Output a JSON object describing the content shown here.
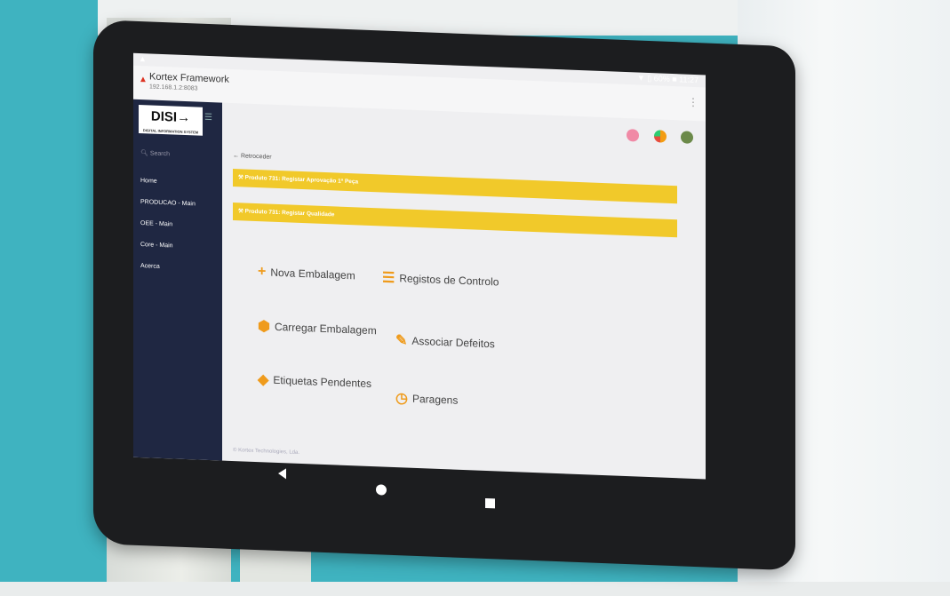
{
  "status": {
    "left": "▲",
    "right": "▼ ▯ 60% ■ 11:27"
  },
  "titlebar": {
    "warn": "▲",
    "app_name": "Kortex Framework",
    "ip": "192.168.1.2:8083",
    "menu": "⋮"
  },
  "sidebar": {
    "logo": "DISI→",
    "logo_sub": "DIGITAL INFORMATION SYSTEM",
    "search_icon": "search-icon",
    "search_placeholder": "Search",
    "items": [
      "Home",
      "PRODUCAO - Main",
      "OEE - Main",
      "Core - Main",
      "Acerca"
    ]
  },
  "main": {
    "back": "← Retroceder",
    "banners": [
      "⚒ Produto 731: Registar Aprovação 1ª Peça",
      "⚒ Produto 731: Registar Qualidade"
    ],
    "actions": [
      {
        "label": "Nova Embalagem",
        "icon": "plus-icon"
      },
      {
        "label": "Registos de Controlo",
        "icon": "list-icon"
      },
      {
        "label": "Carregar Embalagem",
        "icon": "box-icon"
      },
      {
        "label": "Associar Defeitos",
        "icon": "edit-icon"
      },
      {
        "label": "Etiquetas Pendentes",
        "icon": "tags-icon"
      },
      {
        "label": "Paragens",
        "icon": "clock-icon"
      }
    ],
    "footer": "© Kortex Technologies, Lda."
  },
  "colors": {
    "accent": "#ef9b1c",
    "banner": "#f1c92a",
    "sidebar": "#1f2742"
  }
}
